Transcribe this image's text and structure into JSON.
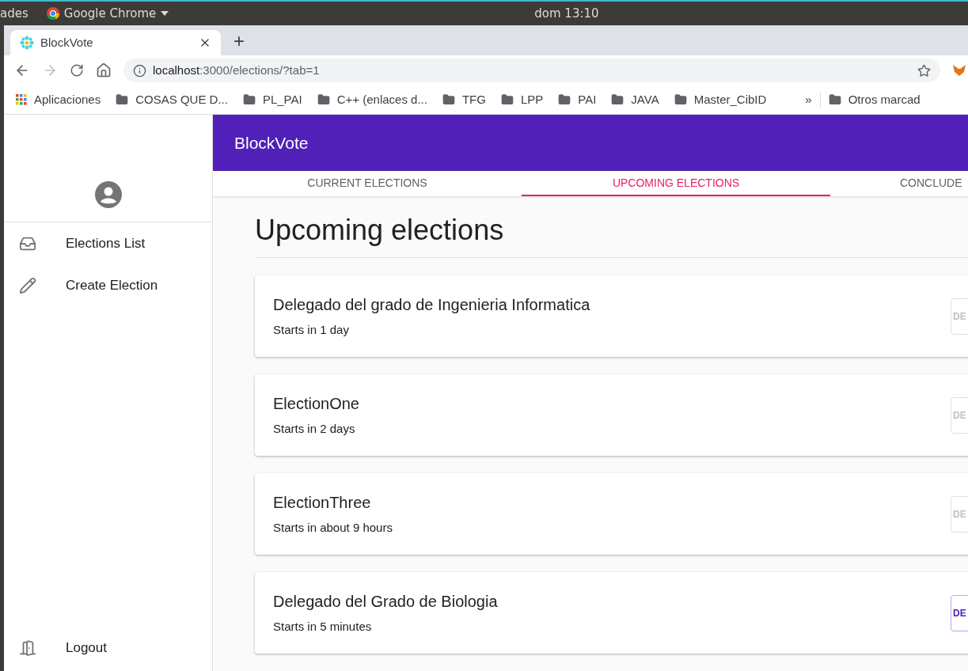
{
  "os_bar": {
    "activities": "ades",
    "app_menu": "Google Chrome",
    "clock": "dom 13:10"
  },
  "browser": {
    "tab_title": "BlockVote",
    "new_tab": "+",
    "url_host": "localhost",
    "url_rest": ":3000/elections/?tab=1",
    "bookmarks": [
      {
        "label": "Aplicaciones",
        "kind": "apps"
      },
      {
        "label": "COSAS QUE D...",
        "kind": "folder"
      },
      {
        "label": "PL_PAI",
        "kind": "folder"
      },
      {
        "label": "C++ (enlaces d...",
        "kind": "folder"
      },
      {
        "label": "TFG",
        "kind": "folder"
      },
      {
        "label": "LPP",
        "kind": "folder"
      },
      {
        "label": "PAI",
        "kind": "folder"
      },
      {
        "label": "JAVA",
        "kind": "folder"
      },
      {
        "label": "Master_CibID",
        "kind": "folder"
      }
    ],
    "more": "»",
    "other_bookmarks": "Otros marcad"
  },
  "sidebar": {
    "items": [
      {
        "label": "Elections List",
        "kind": "list"
      },
      {
        "label": "Create Election",
        "kind": "create"
      }
    ],
    "logout": "Logout"
  },
  "app_bar": {
    "title": "BlockVote"
  },
  "tabs": [
    {
      "label": "CURRENT ELECTIONS",
      "selected": false
    },
    {
      "label": "UPCOMING ELECTIONS",
      "selected": true
    },
    {
      "label": "CONCLUDE",
      "selected": false
    }
  ],
  "heading": "Upcoming elections",
  "elections": [
    {
      "name": "Delegado del grado de Ingenieria Informatica",
      "starts": "Starts in 1 day",
      "button": "DE",
      "disabled": true
    },
    {
      "name": "ElectionOne",
      "starts": "Starts in 2 days",
      "button": "DE",
      "disabled": true
    },
    {
      "name": "ElectionThree",
      "starts": "Starts in about 9 hours",
      "button": "DE",
      "disabled": true
    },
    {
      "name": "Delegado del Grado de Biologia",
      "starts": "Starts in 5 minutes",
      "button": "DE",
      "disabled": false
    }
  ]
}
